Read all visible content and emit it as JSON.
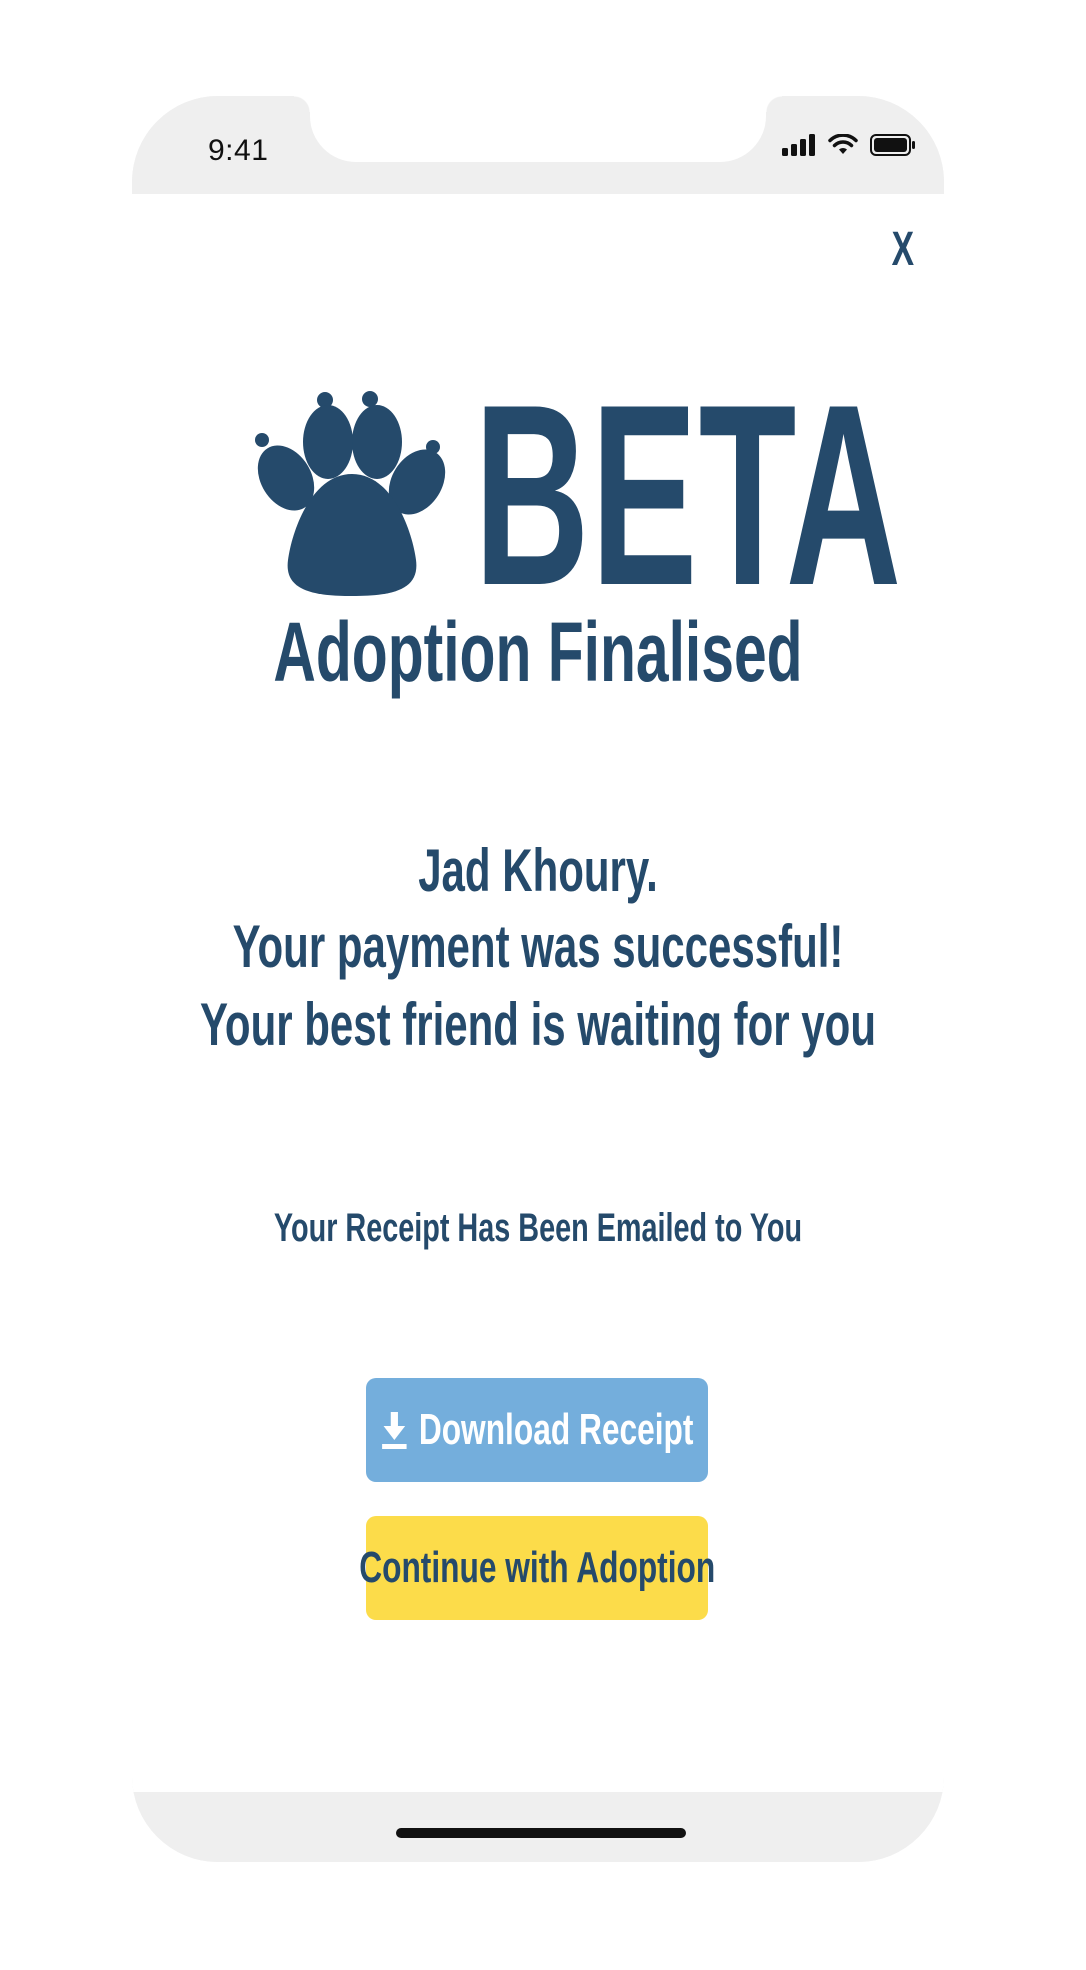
{
  "status_bar": {
    "time": "9:41",
    "icons": [
      "cellular-signal-icon",
      "wifi-icon",
      "battery-icon"
    ]
  },
  "modal": {
    "close_label": "X"
  },
  "logo": {
    "icon": "paw-icon",
    "brand": "BETA"
  },
  "content": {
    "title": "Adoption Finalised",
    "message_name": "Jad Khoury.",
    "message_payment": "Your payment was successful!",
    "message_friend": "Your best friend is waiting for you",
    "receipt_note": "Your Receipt Has Been Emailed to You"
  },
  "actions": {
    "download_label": "Download Receipt",
    "download_icon": "download-icon",
    "continue_label": "Continue with Adoption"
  },
  "colors": {
    "brand": "#254a6b",
    "download_button": "#74aedc",
    "continue_button": "#fcdc4a",
    "frame": "#efefef"
  }
}
